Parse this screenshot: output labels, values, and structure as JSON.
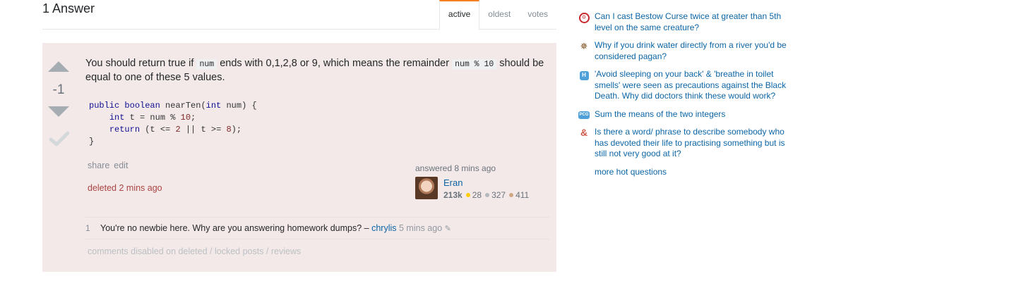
{
  "header": {
    "answers_count": "1 Answer",
    "tabs": [
      {
        "label": "active"
      },
      {
        "label": "oldest"
      },
      {
        "label": "votes"
      }
    ]
  },
  "answer": {
    "vote_count": "-1",
    "text_part1": "You should return true if ",
    "code1": "num",
    "text_part2": " ends with 0,1,2,8 or 9, which means the remainder ",
    "code2": "num % 10",
    "text_part3": " should be equal to one of these 5 values.",
    "code_block": {
      "line1_kw1": "public",
      "line1_kw2": "boolean",
      "line1_rest": " nearTen(",
      "line1_kw3": "int",
      "line1_end": " num) {",
      "line2_kw": "int",
      "line2_rest": " t = num % ",
      "line2_num": "10",
      "line2_end": ";",
      "line3_kw": "return",
      "line3_rest": " (t <= ",
      "line3_num1": "2",
      "line3_mid": " || t >= ",
      "line3_num2": "8",
      "line3_end": ");",
      "line4": "}"
    },
    "menu": {
      "share": "share",
      "edit": "edit"
    },
    "deleted_text": "deleted 2 mins ago",
    "user": {
      "action": "answered 8 mins ago",
      "name": "Eran",
      "reputation": "213k",
      "gold": "28",
      "silver": "327",
      "bronze": "411"
    },
    "comments": [
      {
        "score": "1",
        "text": "You're no newbie here. Why are you answering homework dumps? – ",
        "user": "chrylis",
        "date": "5 mins ago"
      }
    ],
    "comments_disabled": "comments disabled on deleted / locked posts / reviews"
  },
  "sidebar": {
    "hot_questions": [
      {
        "icon": "rpg-icon",
        "title": "Can I cast Bestow Curse twice at greater than 5th level on the same creature?"
      },
      {
        "icon": "mythology-icon",
        "title": "Why if you drink water directly from a river you'd be considered pagan?"
      },
      {
        "icon": "history-icon",
        "title": "'Avoid sleeping on your back' & 'breathe in toilet smells' were seen as precautions against the Black Death. Why did doctors think these would work?"
      },
      {
        "icon": "puzzling-icon",
        "title": "Sum the means of the two integers"
      },
      {
        "icon": "ell-icon",
        "title": "Is there a word/ phrase to describe somebody who has devoted their life to practising something but is still not very good at it?"
      }
    ],
    "more_label": "more hot questions"
  }
}
